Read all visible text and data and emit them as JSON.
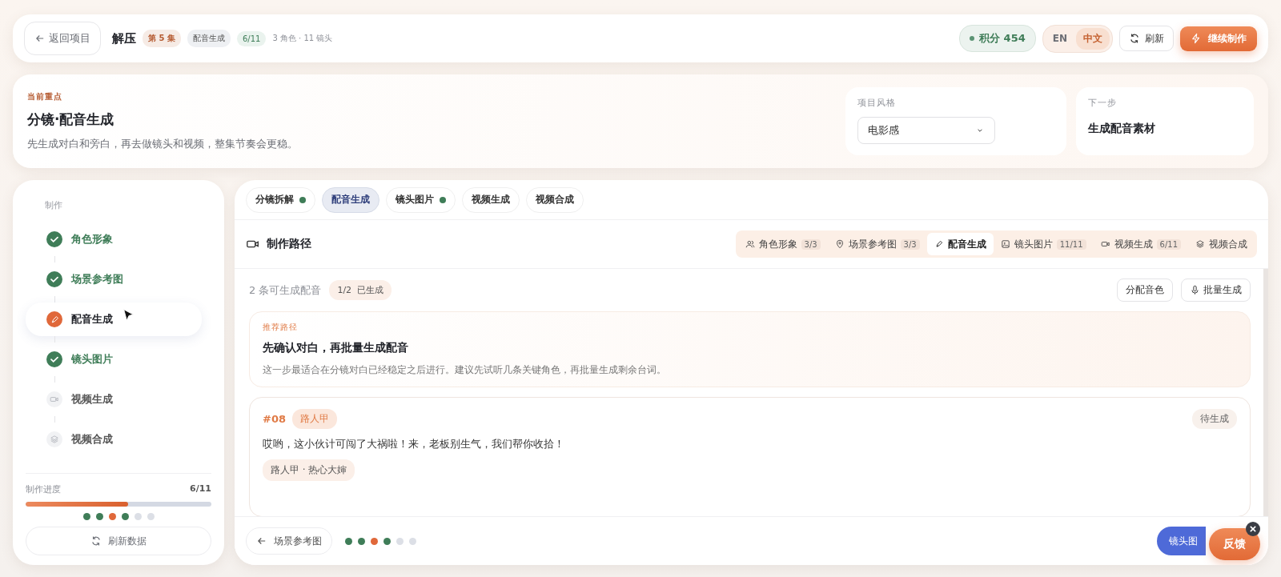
{
  "header": {
    "back_button": "返回项目",
    "title": "解压",
    "badges": [
      {
        "text": "第 5 集",
        "kind": "episode"
      },
      {
        "text": "配音生成",
        "kind": "stage"
      },
      {
        "text": "6/11",
        "kind": "progress"
      }
    ],
    "meta": "3 角色 · 11 镜头",
    "points": "积分 454",
    "languages": [
      {
        "label": "EN",
        "selected": false
      },
      {
        "label": "中文",
        "selected": true
      }
    ],
    "refresh_button": "刷新",
    "continue_button": "继续制作"
  },
  "focus": {
    "eyebrow": "当前重点",
    "title": "分镜·配音生成",
    "description": "先生成对白和旁白，再去做镜头和视频，整集节奏会更稳。",
    "style": {
      "label": "项目风格",
      "value": "电影感"
    },
    "next": {
      "label": "下一步",
      "value": "生成配音素材"
    }
  },
  "sidebar": {
    "section": "制作",
    "steps": [
      {
        "label": "角色形象",
        "done": true,
        "selected": false
      },
      {
        "label": "场景参考图",
        "done": true,
        "selected": false
      },
      {
        "label": "配音生成",
        "done": false,
        "selected": true
      },
      {
        "label": "镜头图片",
        "done": true,
        "selected": false
      },
      {
        "label": "视频生成",
        "done": false,
        "selected": false
      },
      {
        "label": "视频合成",
        "done": false,
        "selected": false
      }
    ],
    "progress": {
      "label": "制作进度",
      "count": "6/11",
      "level": 0.55
    },
    "refresh_button": "刷新数据"
  },
  "main": {
    "tabs": [
      {
        "label": "分镜拆解",
        "done": true,
        "selected": false
      },
      {
        "label": "配音生成",
        "done": false,
        "selected": true
      },
      {
        "label": "镜头图片",
        "done": true,
        "selected": false
      },
      {
        "label": "视频生成",
        "done": false,
        "selected": false
      },
      {
        "label": "视频合成",
        "done": false,
        "selected": false
      }
    ],
    "path": {
      "title": "制作路径",
      "steps": [
        {
          "label": "角色形象",
          "count": "3/3",
          "selected": false
        },
        {
          "label": "场景参考图",
          "count": "3/3",
          "selected": false
        },
        {
          "label": "配音生成",
          "selected": true
        },
        {
          "label": "镜头图片",
          "count": "11/11",
          "selected": false
        },
        {
          "label": "视频生成",
          "count": "6/11",
          "selected": false
        },
        {
          "label": "视频合成",
          "selected": false
        }
      ]
    },
    "summary": "2 条可生成配音",
    "generated_badge": "1/2  已生成",
    "actions": [
      "分配音色",
      "批量生成"
    ],
    "tip": {
      "eyebrow": "推荐路径",
      "title": "先确认对白，再批量生成配音",
      "text": "这一步最适合在分镜对白已经稳定之后进行。建议先试听几条关键角色，再批量生成剩余台词。"
    },
    "lines": [
      {
        "number": "#08",
        "speaker": "路人甲",
        "status": "待生成",
        "text": "哎哟，这小伙计可闯了大祸啦！来，老板别生气，我们帮你收拾！",
        "voice": "路人甲 · 热心大婶"
      }
    ],
    "prev_button": "场景参考图",
    "next_button": "镜头图",
    "feedback_button": "反馈"
  }
}
